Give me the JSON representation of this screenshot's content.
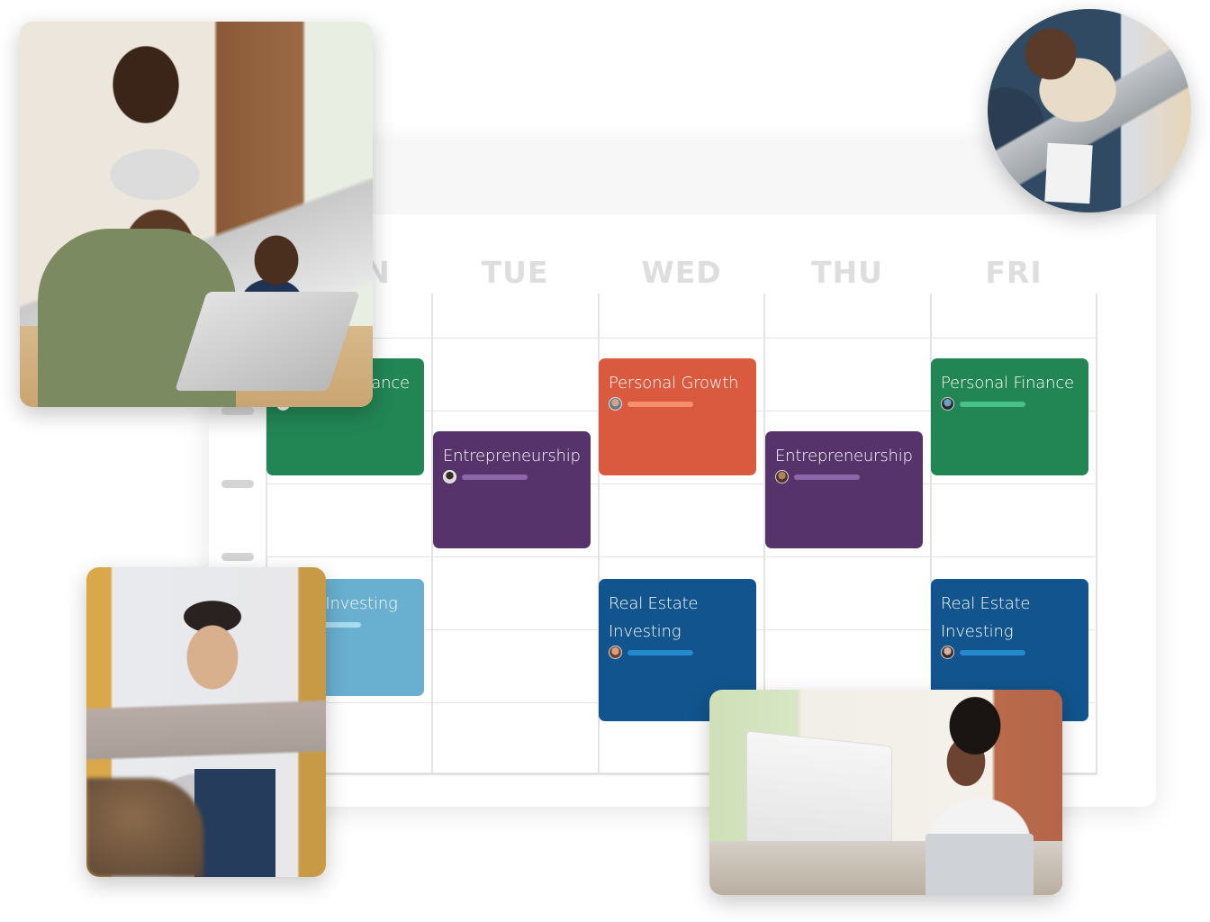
{
  "calendar": {
    "days": [
      "MON",
      "TUE",
      "WED",
      "THU",
      "FRI"
    ],
    "visible_partial_day_fragment": "N",
    "time_slots_shown": 3
  },
  "events": [
    {
      "title": "Personal Finance",
      "day": "MON",
      "category": "personal-finance",
      "color": "#228554",
      "bar_color": "#47c089"
    },
    {
      "title": "Entrepreneurship",
      "day": "TUE",
      "category": "entrepreneurship",
      "color": "#56336b",
      "bar_color": "#8d65a8"
    },
    {
      "title": "Personal Growth",
      "day": "WED",
      "category": "personal-growth",
      "color": "#da5a40",
      "bar_color": "#f5906d"
    },
    {
      "title": "Entrepreneurship",
      "day": "THU",
      "category": "entrepreneurship",
      "color": "#56336b",
      "bar_color": "#8d65a8"
    },
    {
      "title": "Personal Finance",
      "day": "FRI",
      "category": "personal-finance",
      "color": "#228554",
      "bar_color": "#47c089"
    },
    {
      "title": "Stock Investing",
      "day": "MON",
      "category": "stock-investing",
      "color": "#69afcf",
      "bar_color": "#a9dcee"
    },
    {
      "title": "Real Estate Investing",
      "title_lines": [
        "Real Estate",
        "Investing"
      ],
      "day": "WED",
      "category": "real-estate-investing",
      "color": "#12548d",
      "bar_color": "#2589cf"
    },
    {
      "title": "Real Estate Investing",
      "title_lines": [
        "Real Estate",
        "Investing"
      ],
      "day": "FRI",
      "category": "real-estate-investing",
      "color": "#12548d",
      "bar_color": "#2589cf"
    }
  ],
  "photos": [
    {
      "name": "father-with-kids-photo",
      "subject": "father working on laptop with children"
    },
    {
      "name": "woman-overhead-photo",
      "subject": "woman with laptop and notes, overhead view"
    },
    {
      "name": "man-on-couch-photo",
      "subject": "man using laptop on couch"
    },
    {
      "name": "woman-at-desk-photo",
      "subject": "woman working at desktop computer"
    }
  ],
  "colors": {
    "grid_line": "#e3e3e3",
    "day_label": "#dedede",
    "header_band": "#f7f7f7"
  }
}
